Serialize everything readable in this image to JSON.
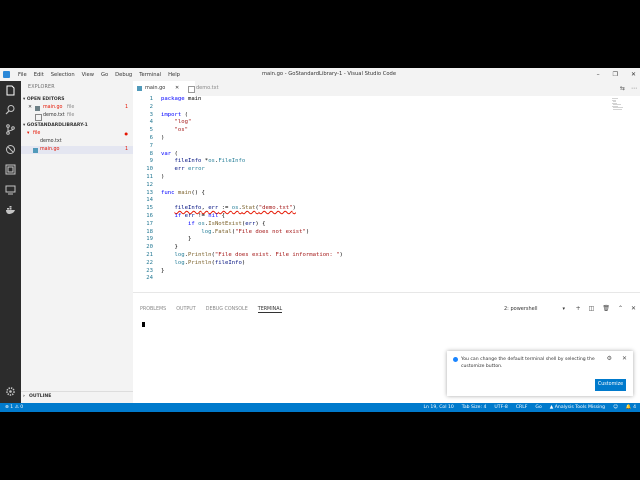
{
  "window": {
    "title": "main.go - GoStandardLibrary-1 - Visual Studio Code",
    "menu": [
      "File",
      "Edit",
      "Selection",
      "View",
      "Go",
      "Debug",
      "Terminal",
      "Help"
    ],
    "controls": [
      "–",
      "❐",
      "✕"
    ]
  },
  "sidebar": {
    "header": "EXPLORER",
    "open_editors_label": "OPEN EDITORS",
    "open_editors": [
      {
        "name": "main.go",
        "path": "file",
        "badge": "1"
      },
      {
        "name": "demo.txt",
        "path": "file",
        "badge": ""
      }
    ],
    "project_label": "GOSTANDARDLIBRARY-1",
    "folder": {
      "name": "file",
      "badge": "●"
    },
    "files": [
      {
        "name": "demo.txt",
        "badge": ""
      },
      {
        "name": "main.go",
        "badge": "1"
      }
    ],
    "outline_label": "OUTLINE"
  },
  "tabs": [
    {
      "label": "main.go",
      "close": "✕"
    },
    {
      "label": "demo.txt",
      "close": ""
    }
  ],
  "tab_actions": [
    "⇆",
    "⋯"
  ],
  "editor": {
    "line_numbers": [
      "1",
      "2",
      "3",
      "4",
      "5",
      "6",
      "7",
      "8",
      "9",
      "10",
      "11",
      "12",
      "13",
      "14",
      "15",
      "16",
      "17",
      "18",
      "19",
      "20",
      "21",
      "22",
      "23",
      "24"
    ]
  },
  "panel": {
    "tabs": [
      "PROBLEMS",
      "OUTPUT",
      "DEBUG CONSOLE",
      "TERMINAL"
    ],
    "terminal_select": "2: powershell",
    "caret": "▾",
    "actions": [
      "+",
      "◫",
      "🗑",
      "⌃",
      "✕"
    ]
  },
  "notification": {
    "message": "You can change the default terminal shell by selecting the customize button.",
    "gear": "⚙",
    "close": "✕",
    "button": "Customize"
  },
  "status": {
    "left": "⊗ 1 ⚠ 0",
    "items": [
      "Ln 19, Col 10",
      "Tab Size: 4",
      "UTF-8",
      "CRLF",
      "Go",
      "▲ Analysis Tools Missing",
      "☺",
      "🔔 4"
    ]
  },
  "colors": {
    "accent": "#007acc",
    "activity": "#2c2c2c",
    "sidebar": "#f3f3f3"
  }
}
